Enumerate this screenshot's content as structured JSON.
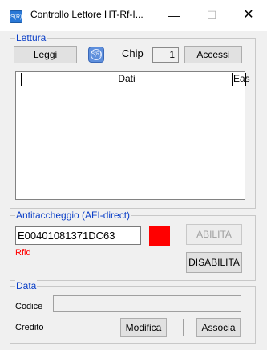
{
  "window": {
    "title": "Controllo Lettore HT-Rf-I...",
    "icon_label": "S(R)",
    "min_glyph": "—",
    "max_glyph": "☐",
    "close_glyph": "✕"
  },
  "lettura": {
    "legend": "Lettura",
    "read_button": "Leggi",
    "logo_label": "S(R)",
    "chip_label": "Chip",
    "chip_value": "1",
    "access_button": "Accessi",
    "list_columns": [
      "Dati",
      "Eas"
    ]
  },
  "antitaccheggio": {
    "legend": "Antitaccheggio (AFI-direct)",
    "tag_value": "E00401081371DC63",
    "status_color": "#ff0000",
    "enable_button": "ABILITA",
    "disable_button": "DISABILITA",
    "type_label": "Rfid",
    "type_color": "#ff0000"
  },
  "data": {
    "legend": "Data",
    "code_label": "Codice",
    "code_value": "",
    "credit_label": "Credito",
    "edit_button": "Modifica",
    "associate_button": "Associa"
  }
}
